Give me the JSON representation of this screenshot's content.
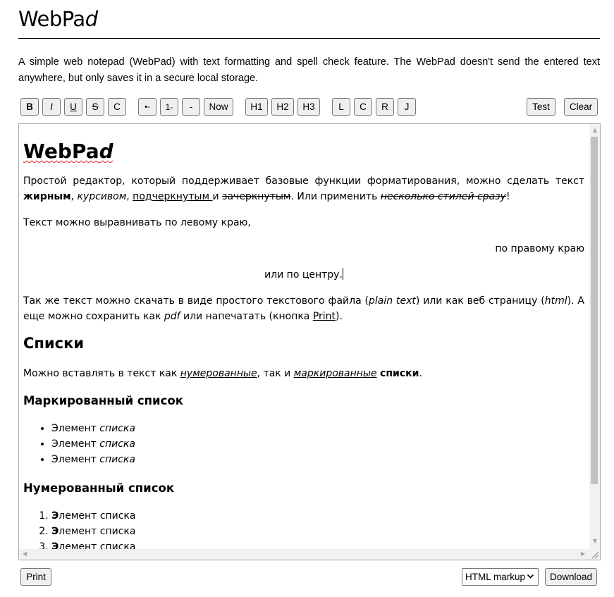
{
  "app": {
    "title_main": "WebPa",
    "title_italic": "d",
    "description": "A simple web notepad (WebPad) with text formatting and spell check feature. The WebPad doesn't send the entered text anywhere, but only saves it in a secure local storage."
  },
  "toolbar": {
    "bold": "B",
    "italic": "I",
    "underline": "U",
    "strike": "S",
    "clear_format": "C",
    "bullet": "•-",
    "numbered": "1-",
    "hr": "-",
    "now": "Now",
    "h1": "H1",
    "h2": "H2",
    "h3": "H3",
    "align_left": "L",
    "align_center": "C",
    "align_right": "R",
    "justify": "J",
    "test": "Test",
    "clear": "Clear"
  },
  "document": {
    "heading_main": "WebPa",
    "heading_italic": "d",
    "p1_a": "Простой редактор, который поддерживает базовые функции форматирования, можно сделать текст ",
    "p1_bold": "жирным",
    "p1_b": ", ",
    "p1_italic": "курсивом",
    "p1_c": ", ",
    "p1_underline": "подчеркнутым ",
    "p1_d": "и ",
    "p1_strike": "зачеркнутым",
    "p1_e": ". Или применить ",
    "p1_multi": "несколько стилей сразу",
    "p1_f": "!",
    "p_left": "Текст можно выравнивать по левому краю,",
    "p_right": "по правому краю",
    "p_center": "или по центру.",
    "p2_a": "Так же текст можно скачать в виде простого текстового файла (",
    "p2_plain": "plain text",
    "p2_b": ") или как веб страницу (",
    "p2_html": "html",
    "p2_c": "). А еще можно сохранить как ",
    "p2_pdf": "pdf",
    "p2_d": " или напечатать (кнопка ",
    "p2_print": "Print",
    "p2_e": ").",
    "h_lists": "Списки",
    "p3_a": "Можно вставлять в текст как ",
    "p3_numbered": "нумерованные",
    "p3_b": ", так и ",
    "p3_bulleted": "маркированные",
    "p3_c": " ",
    "p3_bold": "списки",
    "p3_d": ".",
    "h_bulleted": "Маркированный список",
    "bullet_items": [
      {
        "plain": "Элемент ",
        "italic": "списка"
      },
      {
        "plain": "Элемент ",
        "italic": "списка"
      },
      {
        "plain": "Элемент ",
        "italic": "списка"
      }
    ],
    "h_numbered": "Нумерованный список",
    "numbered_items": [
      {
        "bold": "Э",
        "plain": "лемент списка"
      },
      {
        "bold": "Э",
        "plain": "лемент списка"
      },
      {
        "bold": "Э",
        "plain": "лемент списка"
      }
    ]
  },
  "footer": {
    "print": "Print",
    "format_selected": "HTML markup",
    "download": "Download"
  },
  "icons": {
    "scroll_up": "▲",
    "scroll_down": "▼",
    "scroll_left": "◀",
    "scroll_right": "▶",
    "select_chevron": "⌄"
  }
}
